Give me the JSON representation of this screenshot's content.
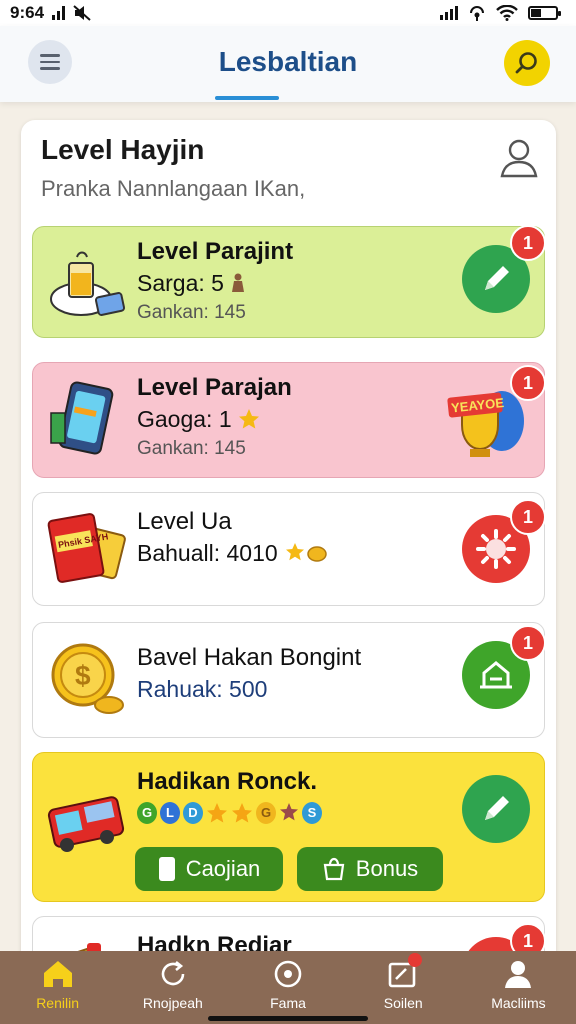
{
  "status_bar": {
    "time": "9:64"
  },
  "header": {
    "title": "Lesbaltian"
  },
  "panel": {
    "title": "Level Hayjin",
    "subtitle": "Pranka Nannlangaan IKan,"
  },
  "cards": [
    {
      "title": "Level Parajint",
      "line": "Sarga: 5",
      "sub": "Gankan: 145",
      "badge": "1",
      "color": "#2fa44f"
    },
    {
      "title": "Level Parajan",
      "line": "Gaoga: 1",
      "sub": "Gankan: 145",
      "badge": "1",
      "color": "#e53a34"
    },
    {
      "title": "Level Ua",
      "line": "Bahuall: 4010",
      "badge": "1",
      "color": "#e53a34"
    },
    {
      "title": "Bavel Hakan Bongint",
      "line": "Rahuak: 500",
      "badge": "1",
      "color": "#3fa52a"
    },
    {
      "title": "Hadikan Ronck.",
      "badge": "",
      "color": "#2fa44f",
      "buttons": [
        {
          "label": "Caojian"
        },
        {
          "label": "Bonus"
        }
      ]
    },
    {
      "title": "Hadkn Rediar"
    }
  ],
  "illustration_text": {
    "phone_box": "Phsik SAYH",
    "sign": "YEAYOE"
  },
  "bottom_nav": [
    {
      "label": "Renilin",
      "icon": "home-icon",
      "active": true
    },
    {
      "label": "Rnojpeah",
      "icon": "refresh-icon"
    },
    {
      "label": "Fama",
      "icon": "target-icon"
    },
    {
      "label": "Soilen",
      "icon": "notes-icon"
    },
    {
      "label": "Macliims",
      "icon": "profile-icon"
    }
  ],
  "colors": {
    "brand": "#1d4e89",
    "accent_yellow": "#f2d300",
    "nav_bg": "#8a6a55"
  }
}
